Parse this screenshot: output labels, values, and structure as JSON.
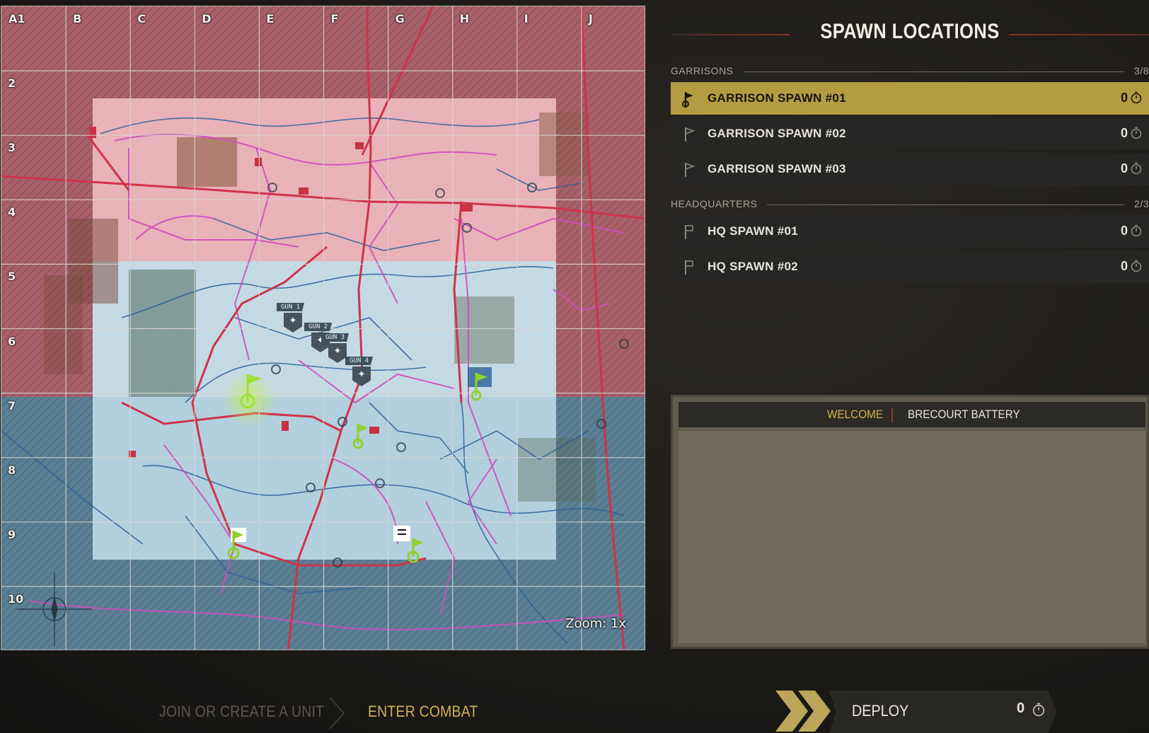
{
  "map": {
    "columns": [
      "A1",
      "B",
      "C",
      "D",
      "E",
      "F",
      "G",
      "H",
      "I",
      "J"
    ],
    "rows": [
      "2",
      "3",
      "4",
      "5",
      "6",
      "7",
      "8",
      "9",
      "10"
    ],
    "zoom_label": "Zoom: 1x",
    "guns": [
      {
        "label": "GUN 1"
      },
      {
        "label": "GUN 2"
      },
      {
        "label": "GUN 3"
      },
      {
        "label": "GUN 4"
      }
    ],
    "axis_zone_color": "#c96d78",
    "allied_zone_color": "#8fb8cf",
    "road_color": "#d0324a",
    "path_color": "#d04bbd",
    "water_color": "#2a5f9a",
    "spawn_pin_color": "#8ed12b"
  },
  "panel": {
    "title": "SPAWN LOCATIONS",
    "garrisons": {
      "header": "GARRISONS",
      "count": "3/8",
      "items": [
        {
          "name": "GARRISON SPAWN #01",
          "count": "0",
          "selected": true
        },
        {
          "name": "GARRISON SPAWN #02",
          "count": "0",
          "selected": false
        },
        {
          "name": "GARRISON SPAWN #03",
          "count": "0",
          "selected": false
        }
      ]
    },
    "headquarters": {
      "header": "HEADQUARTERS",
      "count": "2/3",
      "items": [
        {
          "name": "HQ SPAWN #01",
          "count": "0"
        },
        {
          "name": "HQ SPAWN #02",
          "count": "0"
        }
      ]
    },
    "info": {
      "tab_welcome": "WELCOME",
      "tab_map": "BRECOURT BATTERY"
    },
    "accent_color": "#b49c43"
  },
  "bottom": {
    "step_join": "JOIN OR CREATE A UNIT",
    "step_enter": "ENTER COMBAT",
    "deploy_label": "DEPLOY",
    "deploy_count": "0"
  }
}
